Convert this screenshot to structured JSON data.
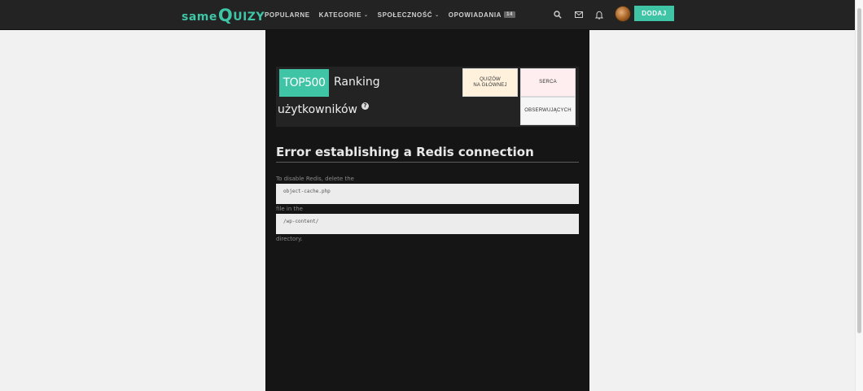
{
  "logo": {
    "part1": "same",
    "part2": "Q",
    "part3": "UIZY"
  },
  "nav": {
    "items": [
      {
        "label": "POPULARNE"
      },
      {
        "label": "KATEGORIE"
      },
      {
        "label": "SPOŁECZNOŚĆ"
      },
      {
        "label": "OPOWIADANIA",
        "badge": "14"
      }
    ],
    "add_label": "DODAJ"
  },
  "ranking": {
    "badge": "TOP500",
    "title_part1": "Ranking",
    "title_part2": "użytkowników",
    "tabs": {
      "quizzes_line1": "QUIZÓW",
      "quizzes_line2": "NA GŁÓWNEJ",
      "hearts": "SERCA",
      "followers": "OBSERWUJĄCYCH"
    }
  },
  "error": {
    "title": "Error establishing a Redis connection",
    "line1": "To disable Redis, delete the",
    "code1": "object-cache.php",
    "line2": "file in the",
    "code2": "/wp-content/",
    "line3": "directory."
  },
  "colors": {
    "accent": "#3fc4a6",
    "topbar": "#232323",
    "main_bg": "#151515",
    "page_bg": "#f1f1f1"
  }
}
